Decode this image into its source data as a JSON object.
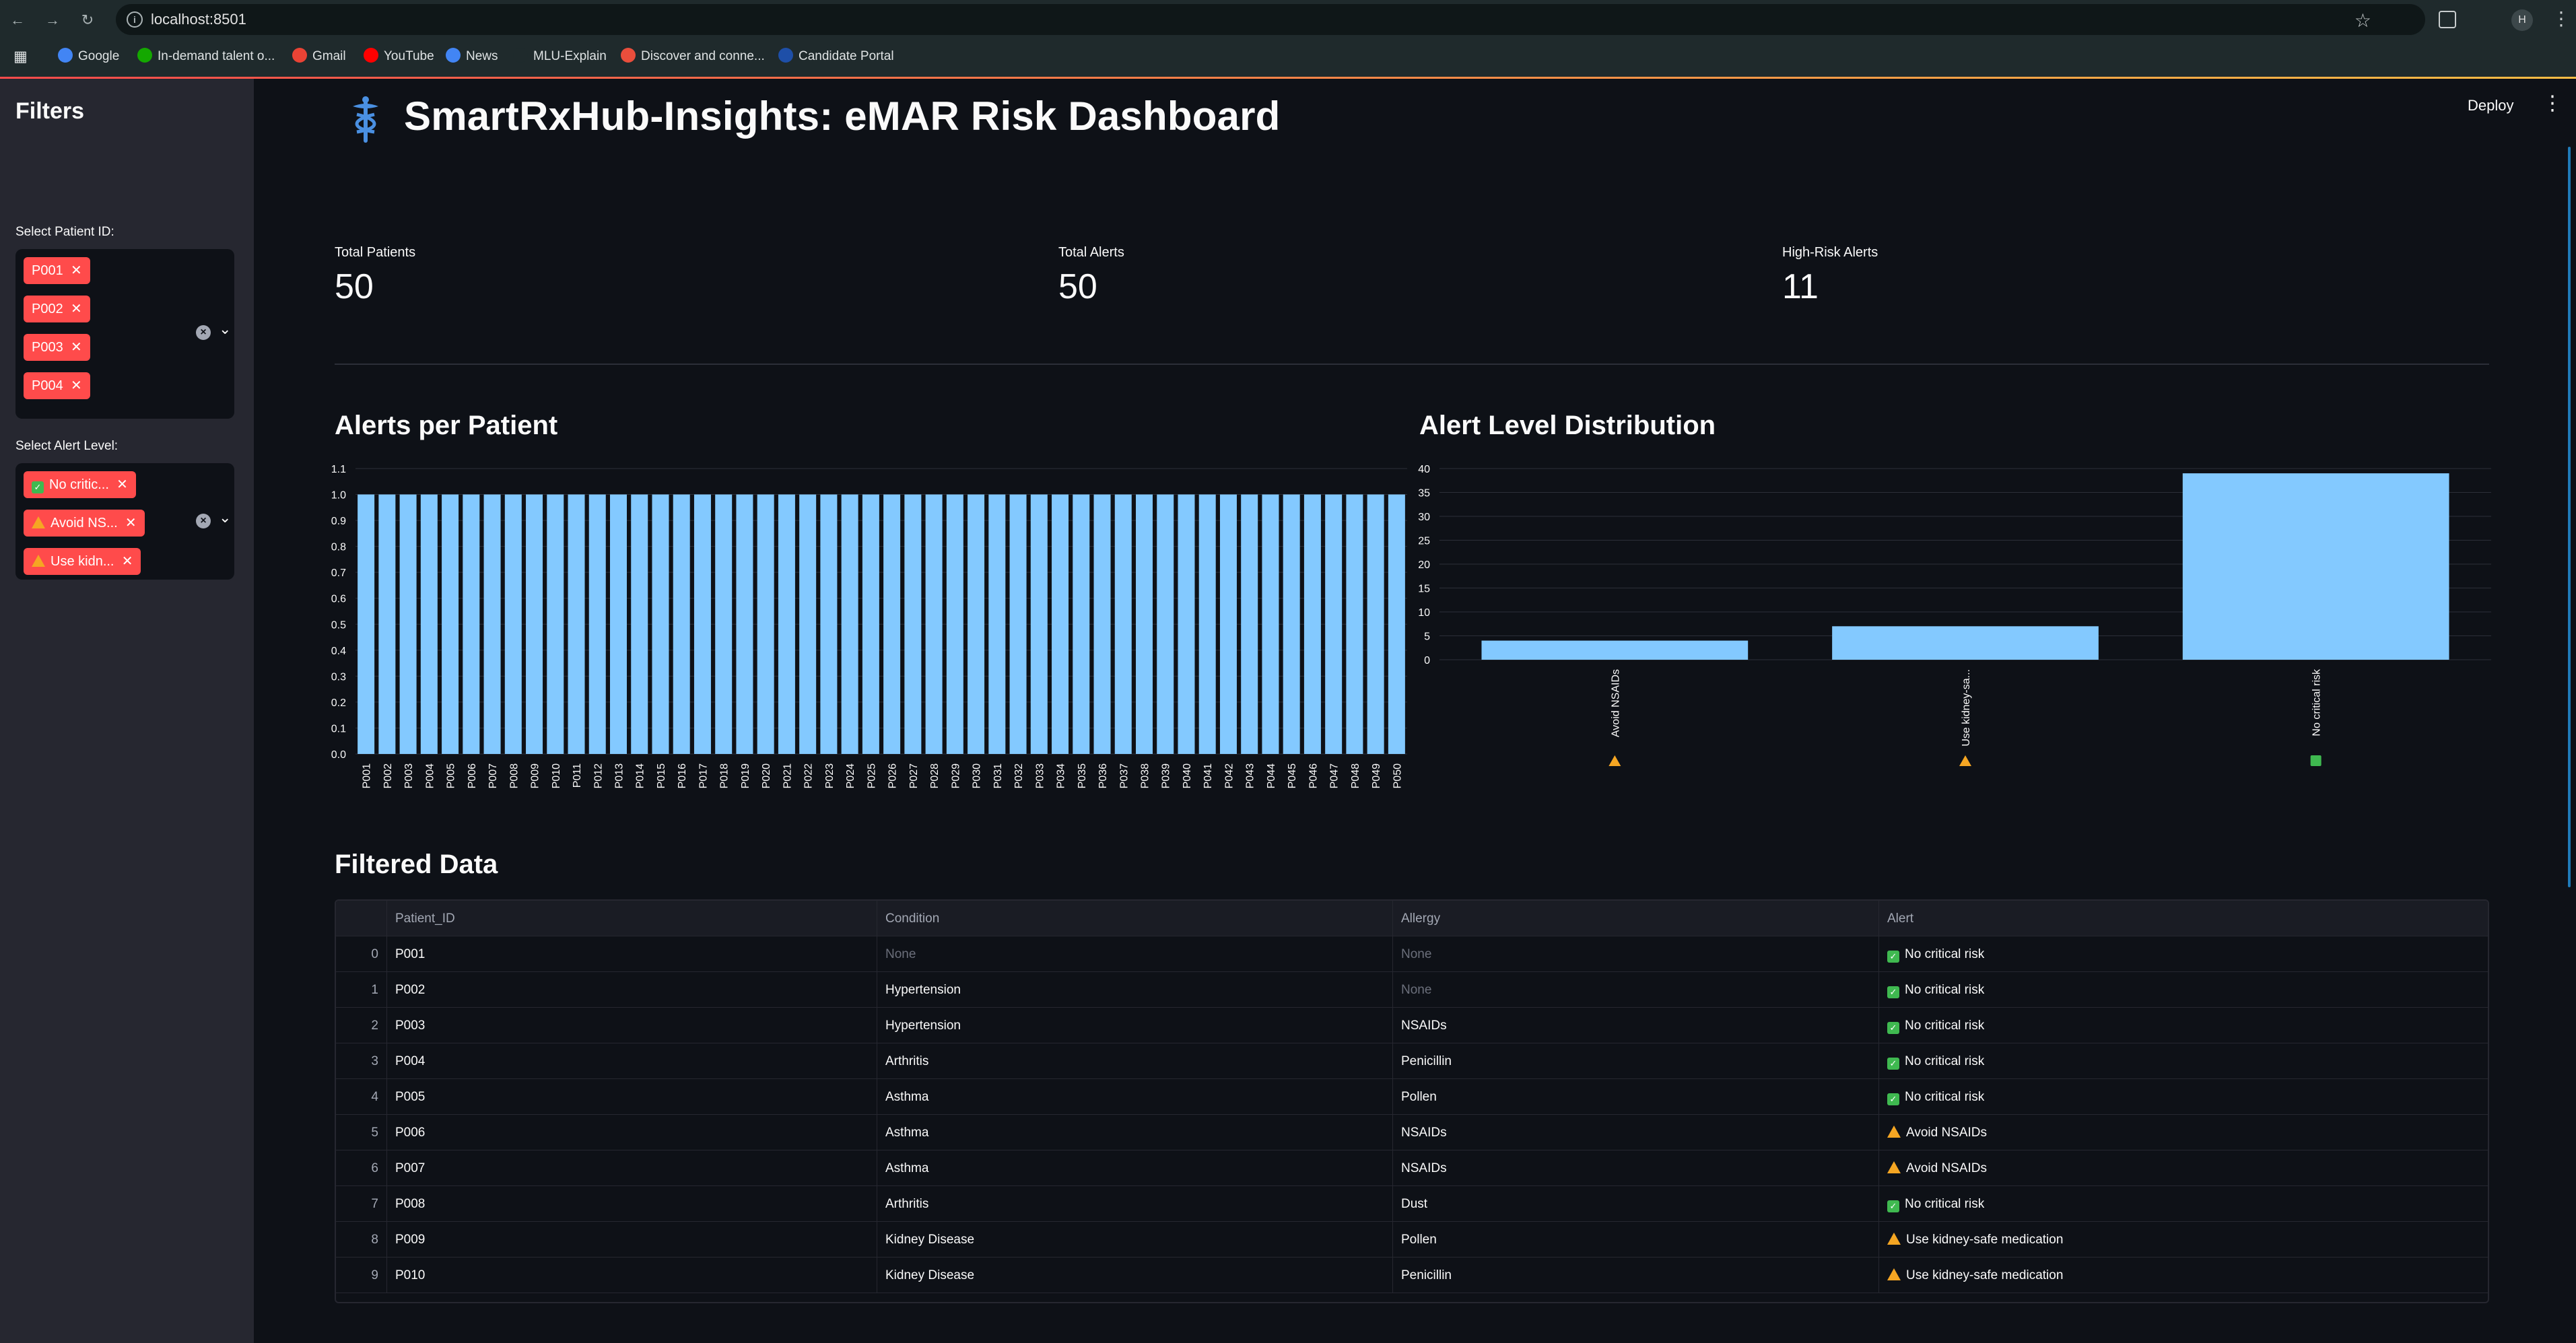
{
  "browser": {
    "url": "localhost:8501",
    "profile_initial": "H",
    "bookmarks": [
      {
        "label": "Google",
        "icon": "google-icon",
        "color": "#4285f4"
      },
      {
        "label": "In-demand talent o...",
        "icon": "upwork-icon",
        "color": "#14a800"
      },
      {
        "label": "Gmail",
        "icon": "gmail-icon",
        "color": "#ea4335"
      },
      {
        "label": "YouTube",
        "icon": "youtube-icon",
        "color": "#ff0000"
      },
      {
        "label": "News",
        "icon": "news-icon",
        "color": "#4285f4"
      },
      {
        "label": "MLU-Explain",
        "icon": "mlu-icon",
        "color": "#1f2a2c"
      },
      {
        "label": "Discover and conne...",
        "icon": "discover-icon",
        "color": "#e94e3c"
      },
      {
        "label": "Candidate Portal",
        "icon": "portal-icon",
        "color": "#1e4fa8"
      }
    ]
  },
  "sidebar": {
    "title": "Filters",
    "patient_filter": {
      "label": "Select Patient ID:",
      "selected": [
        "P001",
        "P002",
        "P003",
        "P004"
      ]
    },
    "alert_filter": {
      "label": "Select Alert Level:",
      "selected": [
        {
          "label": "No critic...",
          "icon": "check-icon"
        },
        {
          "label": "Avoid NS...",
          "icon": "warning-icon"
        },
        {
          "label": "Use kidn...",
          "icon": "warning-icon"
        }
      ]
    }
  },
  "header": {
    "title": "SmartRxHub-Insights: eMAR Risk Dashboard",
    "deploy_label": "Deploy",
    "logo_icon": "caduceus-icon"
  },
  "metrics": [
    {
      "label": "Total Patients",
      "value": "50"
    },
    {
      "label": "Total Alerts",
      "value": "50"
    },
    {
      "label": "High-Risk Alerts",
      "value": "11"
    }
  ],
  "colors": {
    "bar": "#83c9ff",
    "accent": "#ff4b4b",
    "background": "#0e1117",
    "sidebar": "#262730"
  },
  "chart_data": [
    {
      "type": "bar",
      "title": "Alerts per Patient",
      "categories": [
        "P001",
        "P002",
        "P003",
        "P004",
        "P005",
        "P006",
        "P007",
        "P008",
        "P009",
        "P010",
        "P011",
        "P012",
        "P013",
        "P014",
        "P015",
        "P016",
        "P017",
        "P018",
        "P019",
        "P020",
        "P021",
        "P022",
        "P023",
        "P024",
        "P025",
        "P026",
        "P027",
        "P028",
        "P029",
        "P030",
        "P031",
        "P032",
        "P033",
        "P034",
        "P035",
        "P036",
        "P037",
        "P038",
        "P039",
        "P040",
        "P041",
        "P042",
        "P043",
        "P044",
        "P045",
        "P046",
        "P047",
        "P048",
        "P049",
        "P050"
      ],
      "values": [
        1,
        1,
        1,
        1,
        1,
        1,
        1,
        1,
        1,
        1,
        1,
        1,
        1,
        1,
        1,
        1,
        1,
        1,
        1,
        1,
        1,
        1,
        1,
        1,
        1,
        1,
        1,
        1,
        1,
        1,
        1,
        1,
        1,
        1,
        1,
        1,
        1,
        1,
        1,
        1,
        1,
        1,
        1,
        1,
        1,
        1,
        1,
        1,
        1,
        1
      ],
      "yticks": [
        "0.0",
        "0.1",
        "0.2",
        "0.3",
        "0.4",
        "0.5",
        "0.6",
        "0.7",
        "0.8",
        "0.9",
        "1.0",
        "1.1"
      ],
      "ylim": [
        0,
        1.1
      ],
      "grid": true
    },
    {
      "type": "bar",
      "title": "Alert Level Distribution",
      "categories": [
        "Avoid NSAIDs",
        "Use kidney-sa...",
        "No critical risk"
      ],
      "category_icons": [
        "warning-icon",
        "warning-icon",
        "check-icon"
      ],
      "values": [
        4,
        7,
        39
      ],
      "yticks": [
        "0",
        "5",
        "10",
        "15",
        "20",
        "25",
        "30",
        "35",
        "40"
      ],
      "ylim": [
        0,
        40
      ],
      "grid": true
    }
  ],
  "table": {
    "title": "Filtered Data",
    "columns": [
      "",
      "Patient_ID",
      "Condition",
      "Allergy",
      "Alert"
    ],
    "rows": [
      {
        "idx": "0",
        "id": "P001",
        "condition": "None",
        "allergy": "None",
        "alert": "No critical risk",
        "level": "ok"
      },
      {
        "idx": "1",
        "id": "P002",
        "condition": "Hypertension",
        "allergy": "None",
        "alert": "No critical risk",
        "level": "ok"
      },
      {
        "idx": "2",
        "id": "P003",
        "condition": "Hypertension",
        "allergy": "NSAIDs",
        "alert": "No critical risk",
        "level": "ok"
      },
      {
        "idx": "3",
        "id": "P004",
        "condition": "Arthritis",
        "allergy": "Penicillin",
        "alert": "No critical risk",
        "level": "ok"
      },
      {
        "idx": "4",
        "id": "P005",
        "condition": "Asthma",
        "allergy": "Pollen",
        "alert": "No critical risk",
        "level": "ok"
      },
      {
        "idx": "5",
        "id": "P006",
        "condition": "Asthma",
        "allergy": "NSAIDs",
        "alert": "Avoid NSAIDs",
        "level": "warn"
      },
      {
        "idx": "6",
        "id": "P007",
        "condition": "Asthma",
        "allergy": "NSAIDs",
        "alert": "Avoid NSAIDs",
        "level": "warn"
      },
      {
        "idx": "7",
        "id": "P008",
        "condition": "Arthritis",
        "allergy": "Dust",
        "alert": "No critical risk",
        "level": "ok"
      },
      {
        "idx": "8",
        "id": "P009",
        "condition": "Kidney Disease",
        "allergy": "Pollen",
        "alert": "Use kidney-safe medication",
        "level": "warn"
      },
      {
        "idx": "9",
        "id": "P010",
        "condition": "Kidney Disease",
        "allergy": "Penicillin",
        "alert": "Use kidney-safe medication",
        "level": "warn"
      }
    ]
  }
}
